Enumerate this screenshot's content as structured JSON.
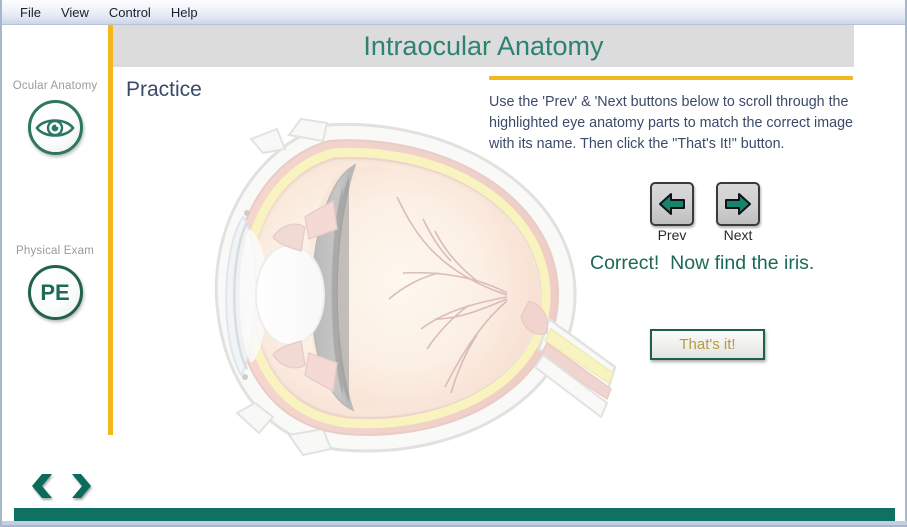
{
  "window": {
    "menu": [
      {
        "label": "File",
        "name": "menu-file"
      },
      {
        "label": "View",
        "name": "menu-view"
      },
      {
        "label": "Control",
        "name": "menu-control"
      },
      {
        "label": "Help",
        "name": "menu-help"
      }
    ]
  },
  "header": {
    "title": "Intraocular Anatomy",
    "title_color": "#2e8271",
    "band_color": "#dcdcdc"
  },
  "sidebar": {
    "accent_color": "#f4b81d",
    "items": [
      {
        "label": "Ocular Anatomy",
        "icon": "eye-icon"
      },
      {
        "label": "Physical Exam",
        "icon": "pe-icon",
        "icon_text": "PE"
      }
    ]
  },
  "main": {
    "section_heading": "Practice",
    "diagram": {
      "name": "eye-anatomy-cross-section",
      "description": "Sagittal cross-section of the human eye"
    }
  },
  "right_panel": {
    "rule_color": "#f0b91d",
    "instructions": "Use the 'Prev' & 'Next buttons below to scroll through the  highlighted eye anatomy parts to match the correct image with its name. Then click the \"That's It!\" button.",
    "prev_button": "Prev",
    "next_button": "Next",
    "feedback": "Correct!  Now find the iris.",
    "feedback_color": "#1c6a56",
    "confirm_button": "That's it!",
    "confirm_button_text_color": "#b89a3e"
  },
  "footer": {
    "back_arrow": "back-arrow-icon",
    "forward_arrow": "forward-arrow-icon",
    "bar_color": "#0f7162"
  }
}
